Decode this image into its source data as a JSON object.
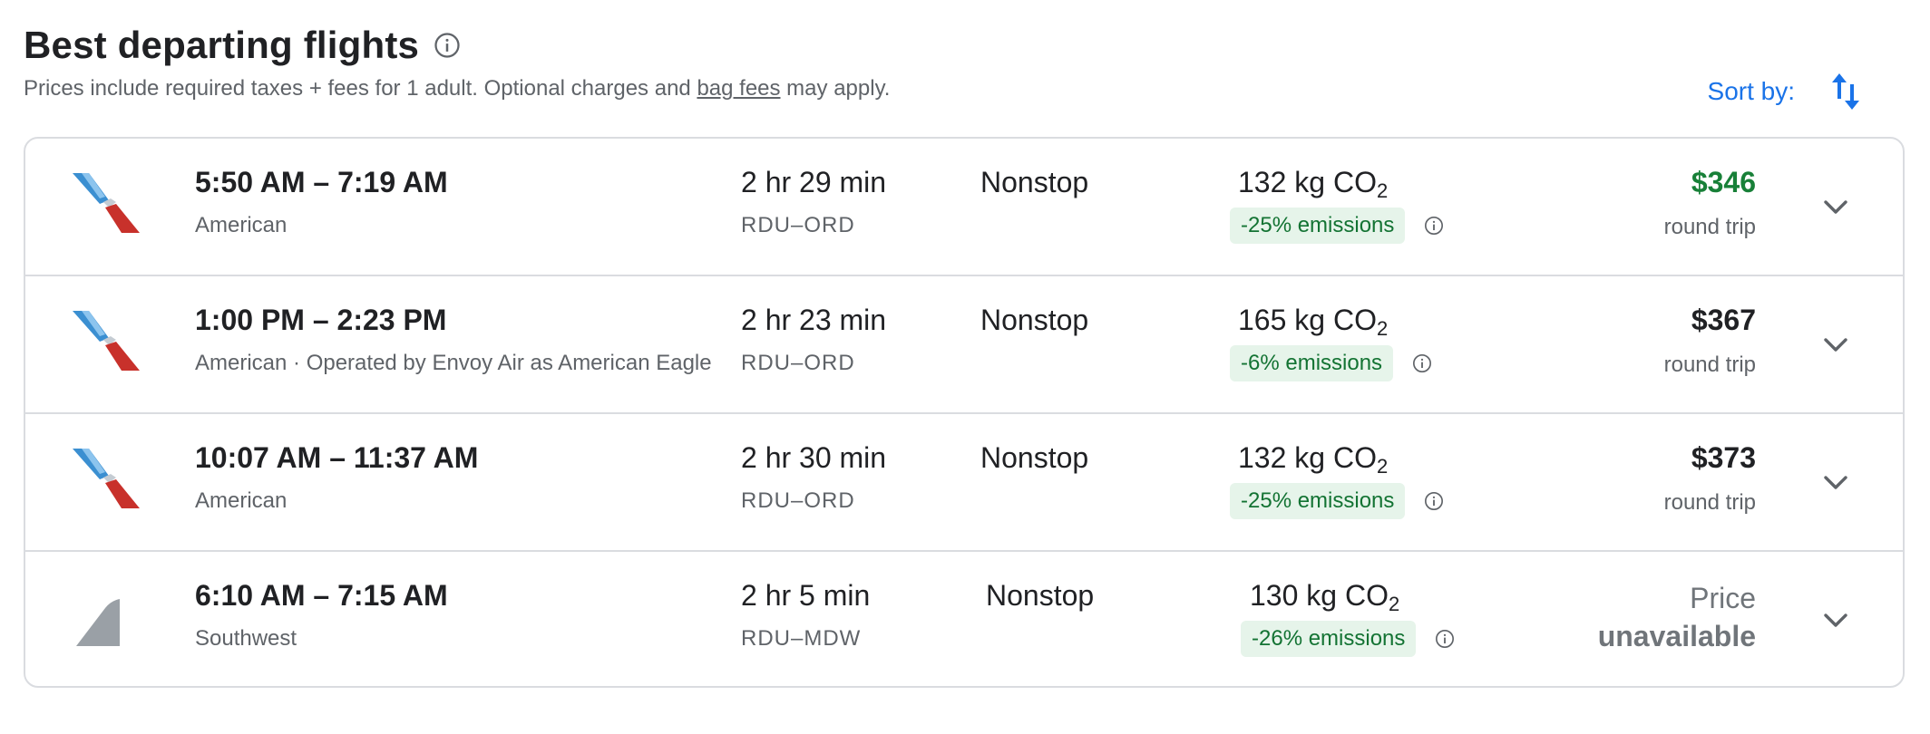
{
  "header": {
    "title": "Best departing flights",
    "subtitle_pre": "Prices include required taxes + fees for 1 adult. Optional charges and ",
    "subtitle_link": "bag fees",
    "subtitle_post": " may apply.",
    "sort_label": "Sort by:"
  },
  "colors": {
    "accent": "#1a73e8",
    "green_price": "#188038",
    "badge_bg": "#e6f4ea",
    "badge_text": "#137333",
    "american_blue": "#3b8fd1",
    "american_red": "#c8312b",
    "southwest_gray": "#9aa0a6"
  },
  "flights": [
    {
      "logo": "american-airlines-logo",
      "times": "5:50 AM – 7:19 AM",
      "airline": "American",
      "duration": "2 hr 29 min",
      "route": "RDU–ORD",
      "stops": "Nonstop",
      "co2_value": "132 kg CO",
      "co2_sub": "2",
      "emissions": "-25% emissions",
      "price": "$346",
      "price_sub": "round trip"
    },
    {
      "logo": "american-airlines-logo",
      "times": "1:00 PM – 2:23 PM",
      "airline": "American · Operated by Envoy Air as American Eagle",
      "duration": "2 hr 23 min",
      "route": "RDU–ORD",
      "stops": "Nonstop",
      "co2_value": "165 kg CO",
      "co2_sub": "2",
      "emissions": "-6% emissions",
      "price": "$367",
      "price_sub": "round trip"
    },
    {
      "logo": "american-airlines-logo",
      "times": "10:07 AM – 11:37 AM",
      "airline": "American",
      "duration": "2 hr 30 min",
      "route": "RDU–ORD",
      "stops": "Nonstop",
      "co2_value": "132 kg CO",
      "co2_sub": "2",
      "emissions": "-25% emissions",
      "price": "$373",
      "price_sub": "round trip"
    },
    {
      "logo": "southwest-logo",
      "times": "6:10 AM – 7:15 AM",
      "airline": "Southwest",
      "duration": "2 hr 5 min",
      "route": "RDU–MDW",
      "stops": "Nonstop",
      "co2_value": "130 kg CO",
      "co2_sub": "2",
      "emissions": "-26% emissions",
      "price_line1": "Price",
      "price_line2": "unavailable"
    }
  ]
}
